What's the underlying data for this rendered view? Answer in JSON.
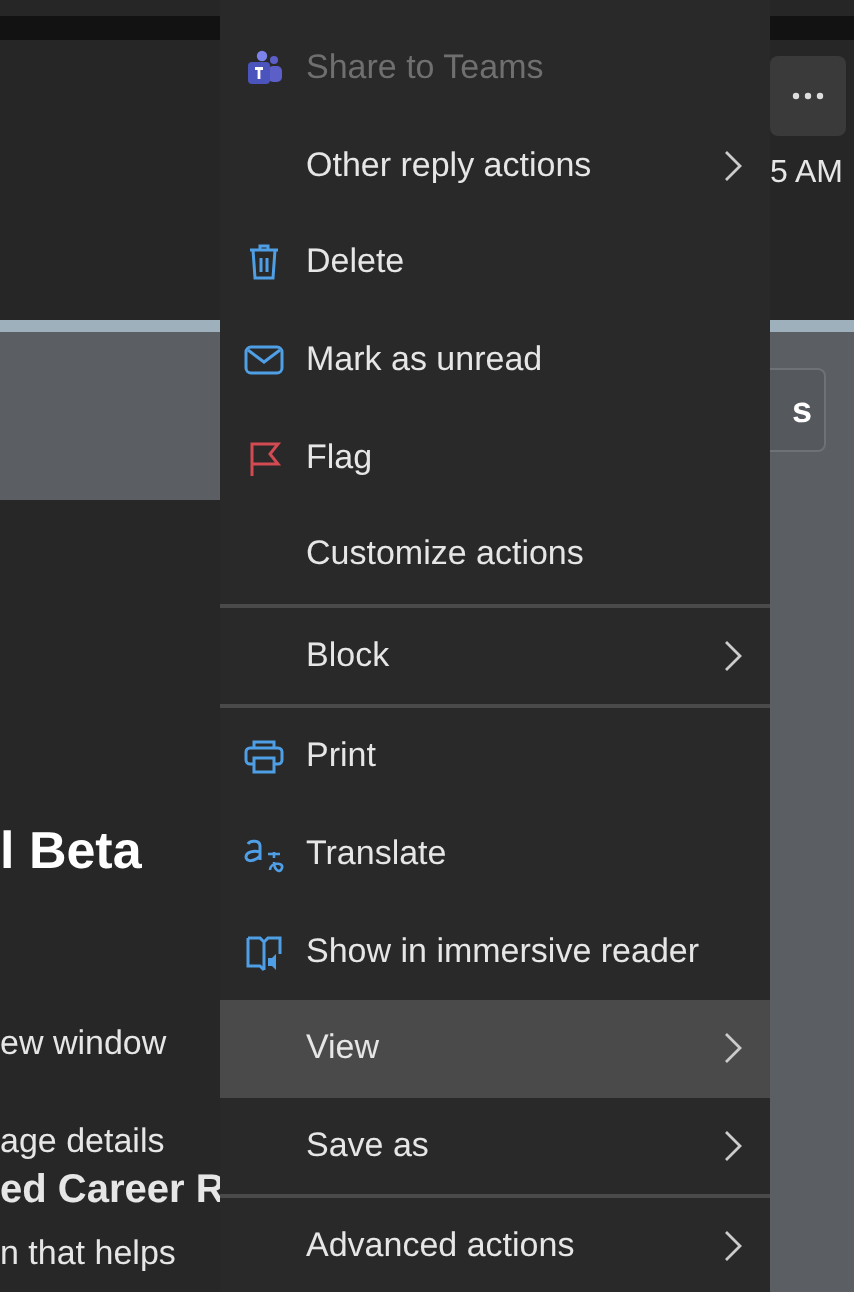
{
  "background": {
    "heading": "l Beta",
    "lines": [
      {
        "text": "ew window",
        "bold": false
      },
      {
        "text": "age details",
        "bold": false
      },
      {
        "text": "ed Career R",
        "bold": true
      },
      {
        "text": "n that helps",
        "bold": false
      }
    ],
    "time": "5 AM",
    "button": "s"
  },
  "menu": {
    "sections": [
      [
        {
          "label": "Share to Teams",
          "submenu": false,
          "disabled": true,
          "selected": false
        },
        {
          "label": "Other reply actions",
          "submenu": true,
          "disabled": false,
          "selected": false
        },
        {
          "label": "Delete",
          "submenu": false,
          "disabled": false,
          "selected": false
        },
        {
          "label": "Mark as unread",
          "submenu": false,
          "disabled": false,
          "selected": false
        },
        {
          "label": "Flag",
          "submenu": false,
          "disabled": false,
          "selected": false
        },
        {
          "label": "Customize actions",
          "submenu": false,
          "disabled": false,
          "selected": false
        }
      ],
      [
        {
          "label": "Block",
          "submenu": true,
          "disabled": false,
          "selected": false
        }
      ],
      [
        {
          "label": "Print",
          "submenu": false,
          "disabled": false,
          "selected": false
        },
        {
          "label": "Translate",
          "submenu": false,
          "disabled": false,
          "selected": false
        },
        {
          "label": "Show in immersive reader",
          "submenu": false,
          "disabled": false,
          "selected": false
        },
        {
          "label": "View",
          "submenu": true,
          "disabled": false,
          "selected": true
        },
        {
          "label": "Save as",
          "submenu": true,
          "disabled": false,
          "selected": false
        }
      ],
      [
        {
          "label": "Advanced actions",
          "submenu": true,
          "disabled": false,
          "selected": false
        }
      ]
    ]
  }
}
